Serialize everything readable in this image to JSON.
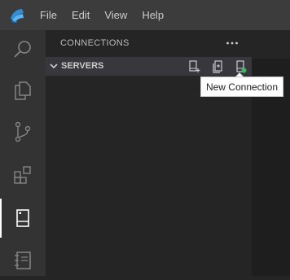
{
  "menu": {
    "items": [
      {
        "label": "File"
      },
      {
        "label": "Edit"
      },
      {
        "label": "View"
      },
      {
        "label": "Help"
      }
    ]
  },
  "activity_bar": {
    "icons": [
      "search-icon",
      "explorer-icon",
      "source-control-icon",
      "extensions-icon",
      "connections-icon",
      "notebooks-icon"
    ],
    "active": "connections-icon"
  },
  "sidebar": {
    "title": "CONNECTIONS",
    "more_icon": "ellipsis-icon",
    "section": {
      "title": "SERVERS",
      "expanded": true,
      "actions": [
        "new-connection-icon",
        "new-server-group-icon",
        "active-connections-icon"
      ]
    }
  },
  "tooltip": {
    "text": "New Connection"
  },
  "colors": {
    "titlebar": "#3c3c3c",
    "activity_bar": "#333333",
    "sidebar": "#252526",
    "section_header": "#37373d",
    "editor": "#1e1e1e",
    "status_green": "#3bb85a"
  }
}
